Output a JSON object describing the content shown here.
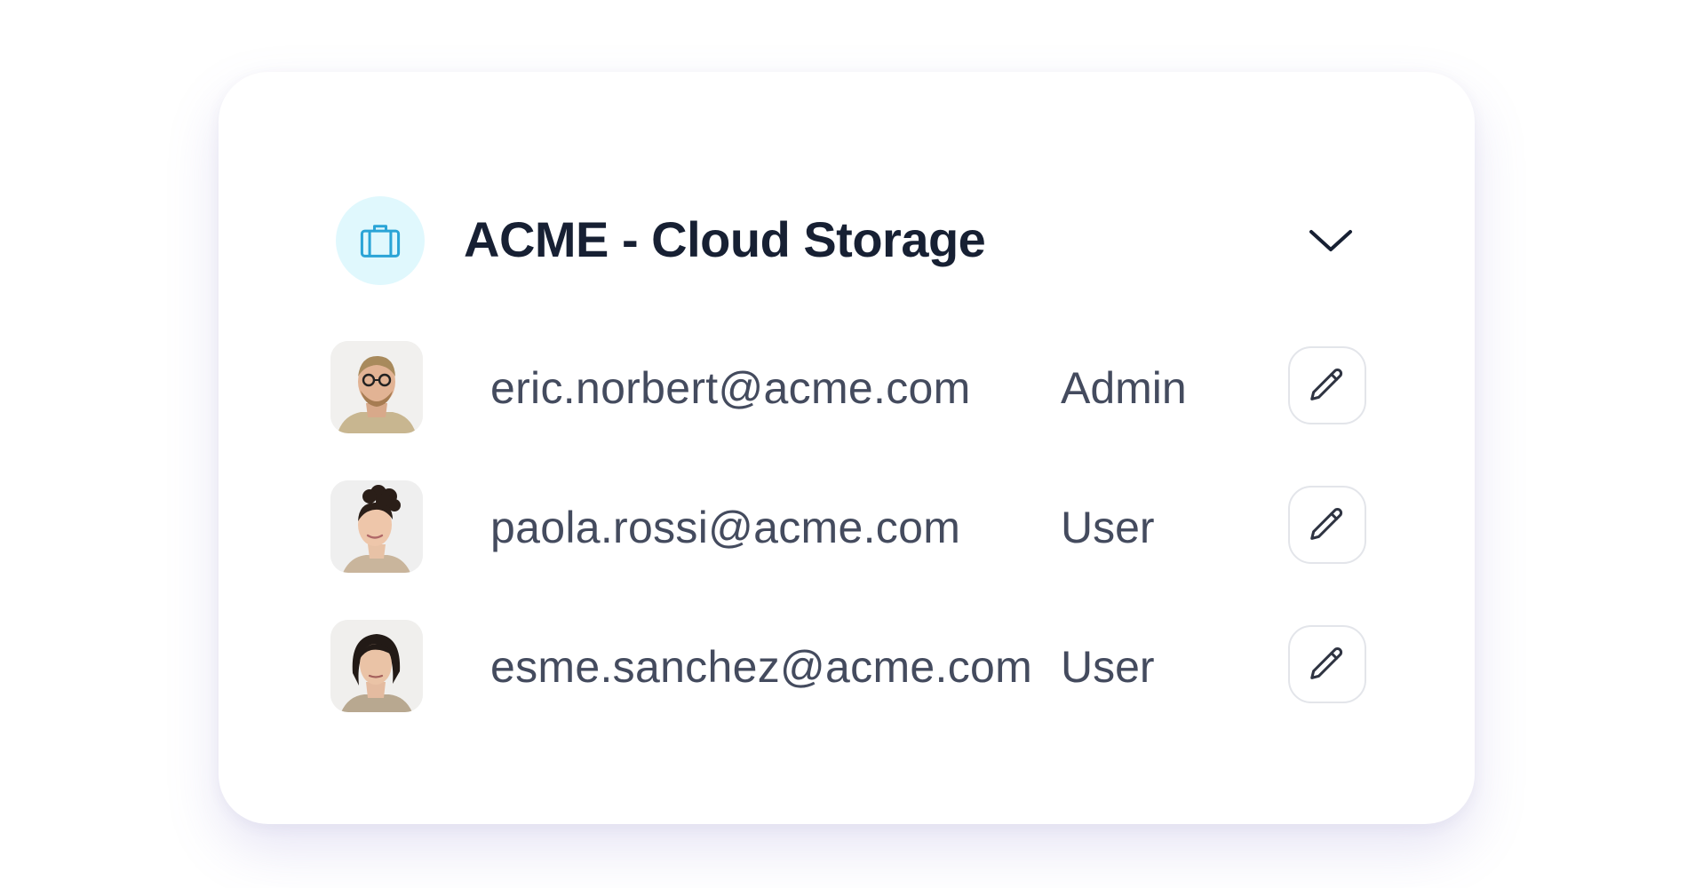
{
  "org": {
    "name": "ACME - Cloud Storage",
    "icon": "briefcase-icon",
    "icon_color": "#2aa4d6",
    "icon_bg": "#e0f8fd",
    "expand_icon": "chevron-down-icon"
  },
  "members": [
    {
      "email": "eric.norbert@acme.com",
      "role": "Admin",
      "avatar": "avatar-man-glasses-beard",
      "edit_icon": "pencil-icon"
    },
    {
      "email": "paola.rossi@acme.com",
      "role": "User",
      "avatar": "avatar-woman-curly-hair",
      "edit_icon": "pencil-icon"
    },
    {
      "email": "esme.sanchez@acme.com",
      "role": "User",
      "avatar": "avatar-woman-dark-hair",
      "edit_icon": "pencil-icon"
    }
  ],
  "colors": {
    "title": "#172033",
    "text": "#444b5e",
    "border": "#e3e5ea"
  }
}
